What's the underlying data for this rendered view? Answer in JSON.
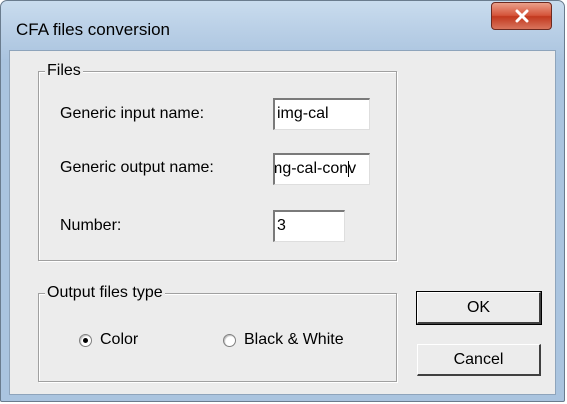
{
  "window": {
    "title": "CFA files conversion",
    "close_icon": "close-icon"
  },
  "files_group": {
    "title": "Files",
    "input_label": "Generic input name:",
    "input_value": "img-cal",
    "output_label": "Generic output name:",
    "output_value": "mg-cal-conv",
    "number_label": "Number:",
    "number_value": "3"
  },
  "output_type_group": {
    "title": "Output files type",
    "options": [
      {
        "label": "Color",
        "checked": true
      },
      {
        "label": "Black & White",
        "checked": false
      }
    ]
  },
  "buttons": {
    "ok_label": "OK",
    "cancel_label": "Cancel"
  },
  "colors": {
    "close_button": "#c7432a",
    "dialog_background": "#ececec",
    "frame": "#aac4df"
  }
}
